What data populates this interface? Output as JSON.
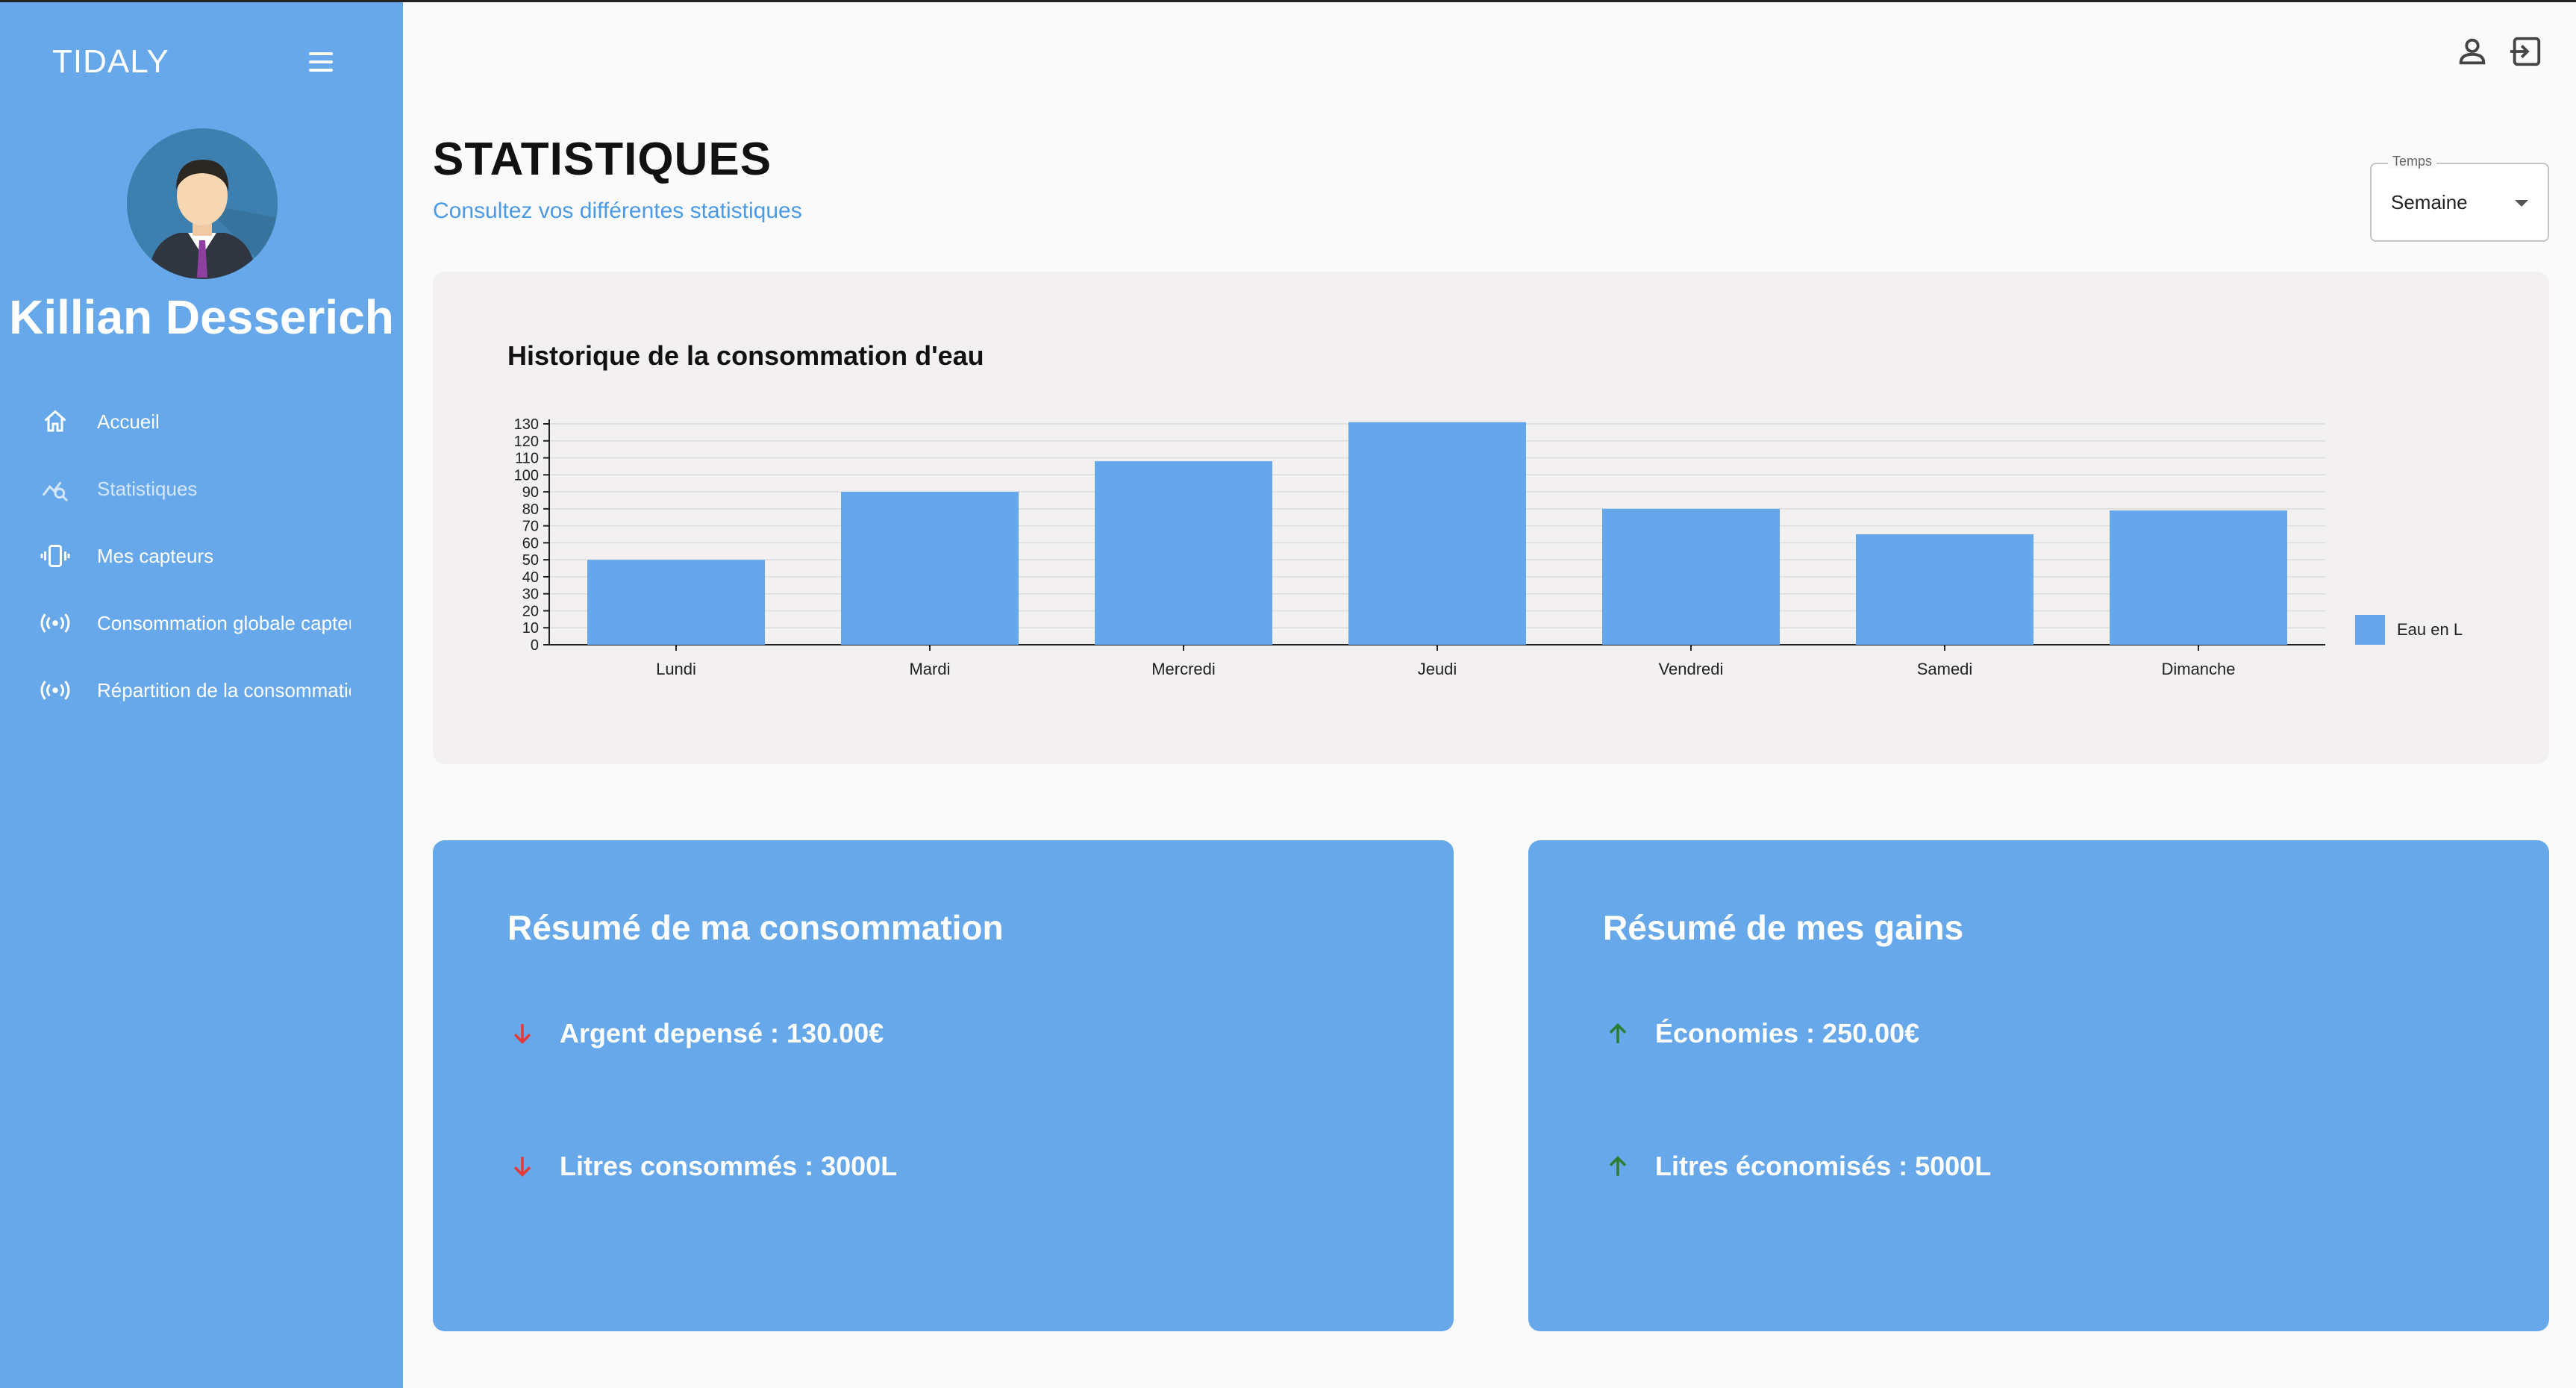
{
  "app": {
    "brand": "TIDALY",
    "user_name": "Killian Desserich"
  },
  "sidebar": {
    "items": [
      {
        "label": "Accueil",
        "icon": "home-icon"
      },
      {
        "label": "Statistiques",
        "icon": "stats-icon",
        "active": true
      },
      {
        "label": "Mes capteurs",
        "icon": "sensor-icon"
      },
      {
        "label": "Consommation globale capteurs",
        "icon": "broadcast-icon"
      },
      {
        "label": "Répartition de la consommation",
        "icon": "broadcast-icon"
      }
    ]
  },
  "header": {
    "title": "STATISTIQUES",
    "subtitle": "Consultez vos différentes statistiques",
    "select": {
      "legend": "Temps",
      "value": "Semaine"
    }
  },
  "colors": {
    "primary": "#66a8ea",
    "bar": "#65a7ea",
    "down": "#e53935",
    "up": "#2e7d32"
  },
  "chart_data": {
    "type": "bar",
    "title": "Historique de la consommation d'eau",
    "categories": [
      "Lundi",
      "Mardi",
      "Mercredi",
      "Jeudi",
      "Vendredi",
      "Samedi",
      "Dimanche"
    ],
    "series": [
      {
        "name": "Eau en L",
        "values": [
          50,
          90,
          108,
          131,
          80,
          65,
          79
        ]
      }
    ],
    "ylim": [
      0,
      130
    ],
    "yticks": [
      0,
      10,
      20,
      30,
      40,
      50,
      60,
      70,
      80,
      90,
      100,
      110,
      120,
      130
    ],
    "grid": true,
    "legend_position": "right"
  },
  "summary_consumption": {
    "title": "Résumé de ma consommation",
    "rows": [
      {
        "label": "Argent depensé : 130.00€",
        "trend": "down"
      },
      {
        "label": "Litres consommés : 3000L",
        "trend": "down"
      }
    ]
  },
  "summary_gains": {
    "title": "Résumé de mes gains",
    "rows": [
      {
        "label": "Économies : 250.00€",
        "trend": "up"
      },
      {
        "label": "Litres économisés : 5000L",
        "trend": "up"
      }
    ]
  }
}
